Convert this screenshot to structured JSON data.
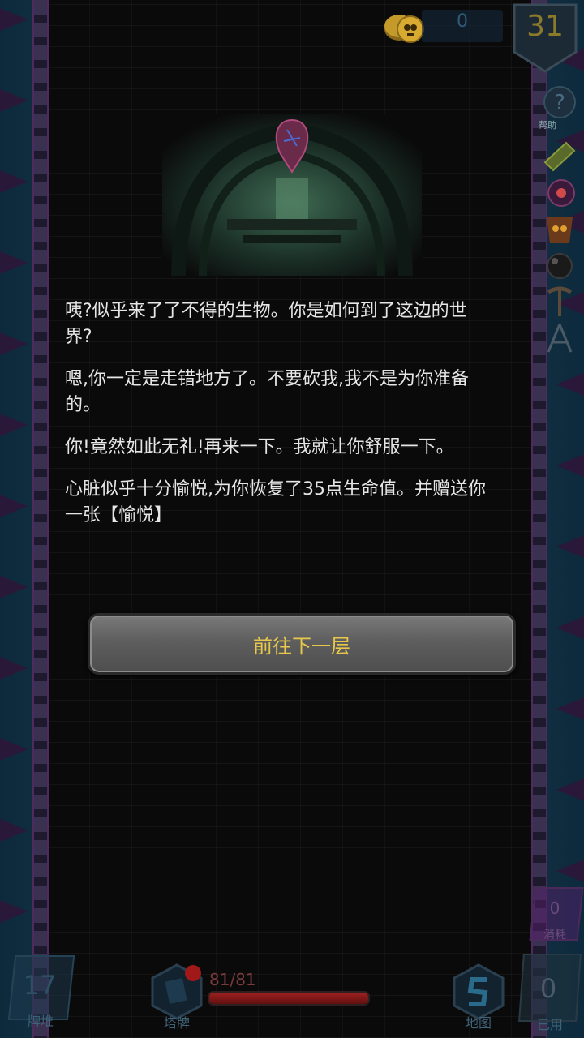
{
  "top_bar": {
    "coins": "0",
    "floor": "31"
  },
  "side_menu": {
    "help_label": "帮助"
  },
  "event": {
    "paragraphs": [
      "咦?似乎来了了不得的生物。你是如何到了这边的世界?",
      "嗯,你一定是走错地方了。不要砍我,我不是为你准备的。",
      "你!竟然如此无礼!再来一下。我就让你舒服一下。",
      "心脏似乎十分愉悦,为你恢复了35点生命值。并赠送你一张【愉悦】"
    ],
    "continue_label": "前往下一层"
  },
  "bottom_hud": {
    "draw_pile": {
      "count": "17",
      "label": "牌堆"
    },
    "tower_cards": {
      "label": "塔牌"
    },
    "hp": {
      "text": "81/81",
      "current": 81,
      "max": 81
    },
    "map": {
      "label": "地图"
    },
    "discard_pile": {
      "count": "0",
      "label": "已用"
    },
    "exhaust_pile": {
      "count": "0",
      "label": "消耗"
    }
  },
  "colors": {
    "button_text": "#e8c84a",
    "hp_red": "#a02020",
    "panel_bg": "#0a0a0a"
  }
}
